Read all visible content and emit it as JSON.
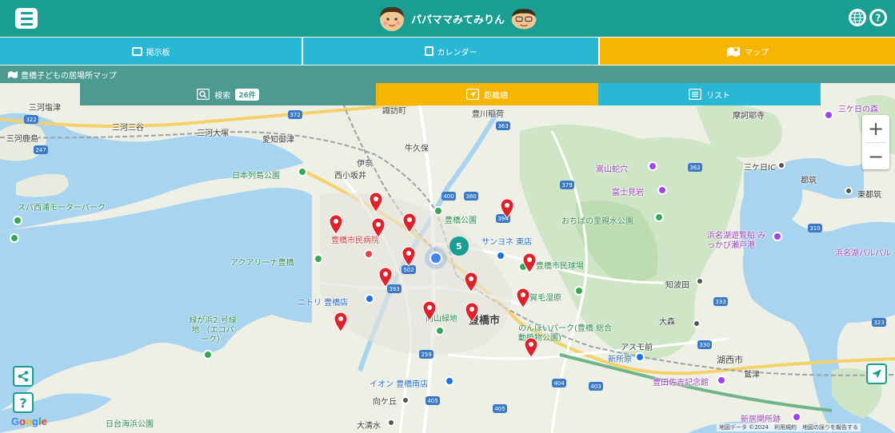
{
  "header": {
    "title": "パパママみてみりん",
    "menu_icon": "hamburger-menu-icon",
    "language_icon": "globe-icon",
    "help_icon": "question-circle-icon",
    "accent_color": "#1a9e91"
  },
  "nav": {
    "tabs": [
      {
        "label": "掲示板",
        "icon": "board-icon",
        "active": false
      },
      {
        "label": "カレンダー",
        "icon": "calendar-icon",
        "active": false
      },
      {
        "label": "マップ",
        "icon": "map-icon",
        "active": true
      }
    ],
    "active_color": "#f6b500",
    "inactive_color": "#29b7d6"
  },
  "breadcrumb": "豊橋子どもの居場所マップ",
  "subtabs": {
    "search_label": "検索",
    "count": "26件",
    "nearby_label": "距離順",
    "list_label": "リスト"
  },
  "map": {
    "cluster_count": "5",
    "zoom_in": "+",
    "zoom_out": "−",
    "share_icon": "share-icon",
    "help_button": "?",
    "locate_icon": "navigation-arrow-icon",
    "logo": "Google",
    "attribution": "地図データ ©2024　利用規約　地図の誤りを報告する",
    "labels": [
      "三河塩津",
      "三河鹿島",
      "三河三谷",
      "三河大塚",
      "愛知御津",
      "諏訪町",
      "豊川稲荷",
      "牛久保",
      "伊奈",
      "西小坂井",
      "日本列島公園",
      "スパ西浦モーターパーク",
      "嵩山蛇穴",
      "富士見岩",
      "おちばの里親水公園",
      "三ケ日IC",
      "三ケ日の森",
      "都筑",
      "東都筑",
      "豊橋公園",
      "サンヨネ 東店",
      "豊橋市民病院",
      "アクアリーナ豊橋",
      "ニトリ 豊橋店",
      "豊橋市民球場",
      "浜名湖遊覧船 みっかび瀬戸港",
      "浜名湖パルパル",
      "知波田",
      "賀毛湿原",
      "豊橋市",
      "向山緑地",
      "大森",
      "緑が浜2 号緑地 （エコパーク）",
      "のんほいパーク(豊橋 総合動植物公園)",
      "アスモ前",
      "新所原",
      "湖西市",
      "鷲津",
      "イオン 豊橋南店",
      "豊田佐吉記念館",
      "向ケ丘",
      "大清水",
      "日台海浜公園",
      "新居関所跡",
      "摩訶耶寺"
    ]
  }
}
